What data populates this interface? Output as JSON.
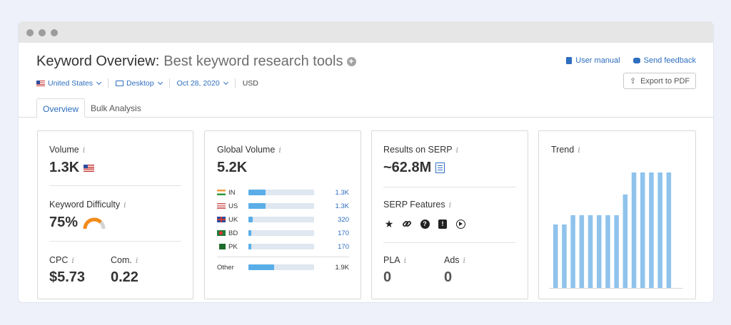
{
  "header": {
    "title_label": "Keyword Overview:",
    "keyword": "Best keyword research tools",
    "add_icon": "plus-circle-icon",
    "user_manual": "User manual",
    "send_feedback": "Send feedback",
    "export_pdf": "Export to PDF"
  },
  "filters": {
    "country": "United States",
    "device": "Desktop",
    "date": "Oct 28, 2020",
    "currency": "USD"
  },
  "tabs": [
    {
      "label": "Overview",
      "active": true
    },
    {
      "label": "Bulk Analysis",
      "active": false
    }
  ],
  "volume": {
    "label": "Volume",
    "value": "1.3K"
  },
  "keyword_difficulty": {
    "label": "Keyword Difficulty",
    "value": "75%",
    "level": 0.75,
    "color": "#f28b1a"
  },
  "cpc": {
    "label": "CPC",
    "value": "$5.73"
  },
  "competition": {
    "label": "Com.",
    "value": "0.22"
  },
  "global_volume": {
    "label": "Global Volume",
    "value": "5.2K",
    "countries": [
      {
        "code": "IN",
        "value": "1.3K",
        "share": 0.25
      },
      {
        "code": "US",
        "value": "1.3K",
        "share": 0.25
      },
      {
        "code": "UK",
        "value": "320",
        "share": 0.06
      },
      {
        "code": "BD",
        "value": "170",
        "share": 0.03
      },
      {
        "code": "PK",
        "value": "170",
        "share": 0.03
      }
    ],
    "other": {
      "code": "Other",
      "value": "1.9K",
      "share": 0.37
    }
  },
  "serp": {
    "results_label": "Results on SERP",
    "results_value": "~62.8M",
    "features_label": "SERP Features",
    "feature_icons": [
      "star-icon",
      "link-icon",
      "question-icon",
      "reviews-icon",
      "video-icon"
    ],
    "pla_label": "PLA",
    "pla_value": "0",
    "ads_label": "Ads",
    "ads_value": "0"
  },
  "trend": {
    "label": "Trend"
  },
  "chart_data": {
    "type": "bar",
    "values": [
      0.55,
      0.55,
      0.63,
      0.63,
      0.63,
      0.63,
      0.63,
      0.63,
      0.81,
      1.0,
      1.0,
      1.0,
      1.0,
      1.0
    ],
    "ylim": [
      0,
      1
    ],
    "color": "#8fc3ec"
  }
}
